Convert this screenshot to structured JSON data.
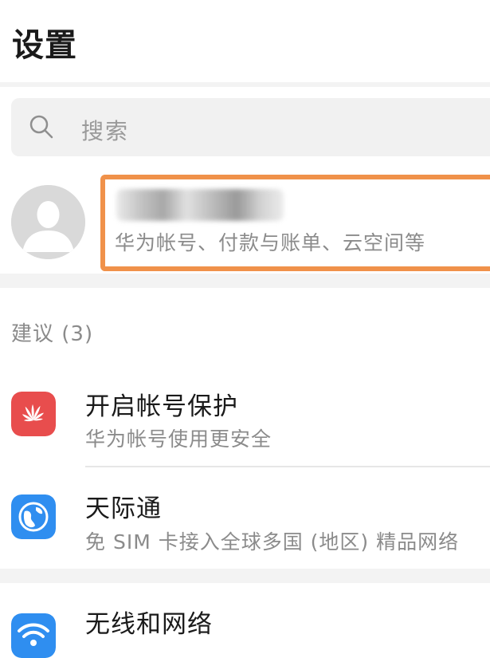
{
  "header": {
    "title": "设置"
  },
  "search": {
    "placeholder": "搜索",
    "icon": "search-icon"
  },
  "account": {
    "subtitle": "华为帐号、付款与账单、云空间等",
    "highlight_color": "#f0914a"
  },
  "suggestions": {
    "title": "建议 (3)",
    "items": [
      {
        "title": "开启帐号保护",
        "subtitle": "华为帐号使用更安全",
        "icon": "huawei-logo-icon",
        "icon_color": "#e84d4d"
      },
      {
        "title": "天际通",
        "subtitle": "免 SIM 卡接入全球多国 (地区) 精品网络",
        "icon": "globe-icon",
        "icon_color": "#2f8ef0"
      }
    ]
  },
  "settings": {
    "items": [
      {
        "title": "无线和网络",
        "icon": "wifi-icon",
        "icon_color": "#2f8ef0"
      }
    ]
  }
}
